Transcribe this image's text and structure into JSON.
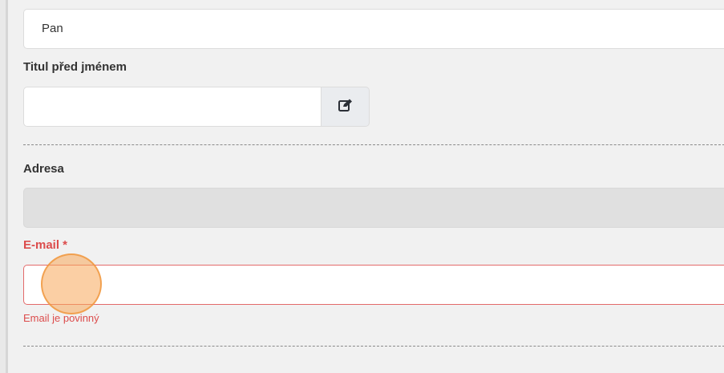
{
  "form": {
    "salutation": {
      "value": "Pan"
    },
    "title_before_name": {
      "label": "Titul před jménem",
      "value": "",
      "edit_icon": "edit-icon"
    },
    "address": {
      "label": "Adresa",
      "value": ""
    },
    "email": {
      "label": "E-mail *",
      "value": "",
      "error": "Email je povinný",
      "error_color": "#dc4c4c"
    }
  }
}
